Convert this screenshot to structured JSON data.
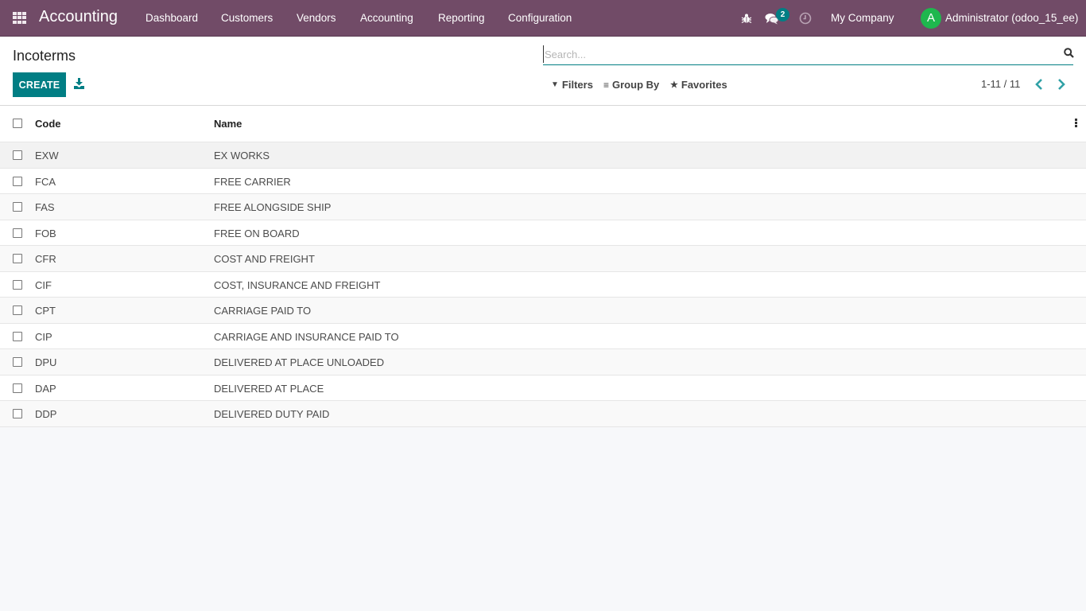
{
  "navbar": {
    "app_name": "Accounting",
    "menu": [
      "Dashboard",
      "Customers",
      "Vendors",
      "Accounting",
      "Reporting",
      "Configuration"
    ],
    "messages_count": "2",
    "company": "My Company",
    "avatar_letter": "A",
    "user": "Administrator (odoo_15_ee)",
    "colors": {
      "primary": "#714b67",
      "accent": "#017e84",
      "avatar": "#1fb74e"
    }
  },
  "control_panel": {
    "title": "Incoterms",
    "create_label": "CREATE",
    "search_placeholder": "Search...",
    "filters_label": "Filters",
    "group_by_label": "Group By",
    "favorites_label": "Favorites",
    "pager": "1-11 / 11"
  },
  "list": {
    "columns": [
      "Code",
      "Name"
    ],
    "rows": [
      {
        "code": "EXW",
        "name": "EX WORKS"
      },
      {
        "code": "FCA",
        "name": "FREE CARRIER"
      },
      {
        "code": "FAS",
        "name": "FREE ALONGSIDE SHIP"
      },
      {
        "code": "FOB",
        "name": "FREE ON BOARD"
      },
      {
        "code": "CFR",
        "name": "COST AND FREIGHT"
      },
      {
        "code": "CIF",
        "name": "COST, INSURANCE AND FREIGHT"
      },
      {
        "code": "CPT",
        "name": "CARRIAGE PAID TO"
      },
      {
        "code": "CIP",
        "name": "CARRIAGE AND INSURANCE PAID TO"
      },
      {
        "code": "DPU",
        "name": "DELIVERED AT PLACE UNLOADED"
      },
      {
        "code": "DAP",
        "name": "DELIVERED AT PLACE"
      },
      {
        "code": "DDP",
        "name": "DELIVERED DUTY PAID"
      }
    ]
  }
}
